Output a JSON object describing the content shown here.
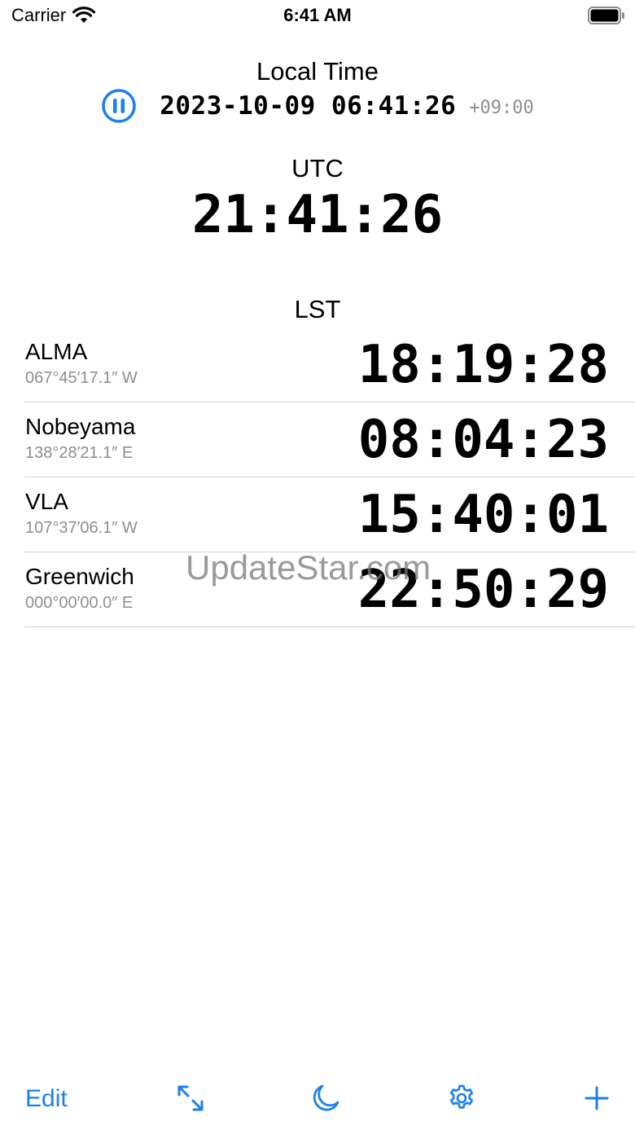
{
  "status_bar": {
    "carrier": "Carrier",
    "time": "6:41 AM",
    "icons": [
      "wifi-icon",
      "battery-icon"
    ]
  },
  "local_time": {
    "label": "Local Time",
    "datetime": "2023-10-09 06:41:26",
    "offset": "+09:00",
    "pause_icon": "pause-circle-icon"
  },
  "utc": {
    "label": "UTC",
    "time": "21:41:26"
  },
  "lst": {
    "label": "LST",
    "stations": [
      {
        "name": "ALMA",
        "coordinate": "067°45′17.1″ W",
        "time": "18:19:28"
      },
      {
        "name": "Nobeyama",
        "coordinate": "138°28′21.1″ E",
        "time": "08:04:23"
      },
      {
        "name": "VLA",
        "coordinate": "107°37′06.1″ W",
        "time": "15:40:01"
      },
      {
        "name": "Greenwich",
        "coordinate": "000°00′00.0″ E",
        "time": "22:50:29"
      }
    ]
  },
  "watermark": "UpdateStar.com",
  "toolbar": {
    "edit_label": "Edit",
    "icons": [
      "expand-icon",
      "moon-icon",
      "gear-icon",
      "plus-icon"
    ]
  },
  "colors": {
    "accent": "#1a7ff0",
    "secondary_text": "#8e8e93",
    "separator": "#d1d1d6"
  }
}
